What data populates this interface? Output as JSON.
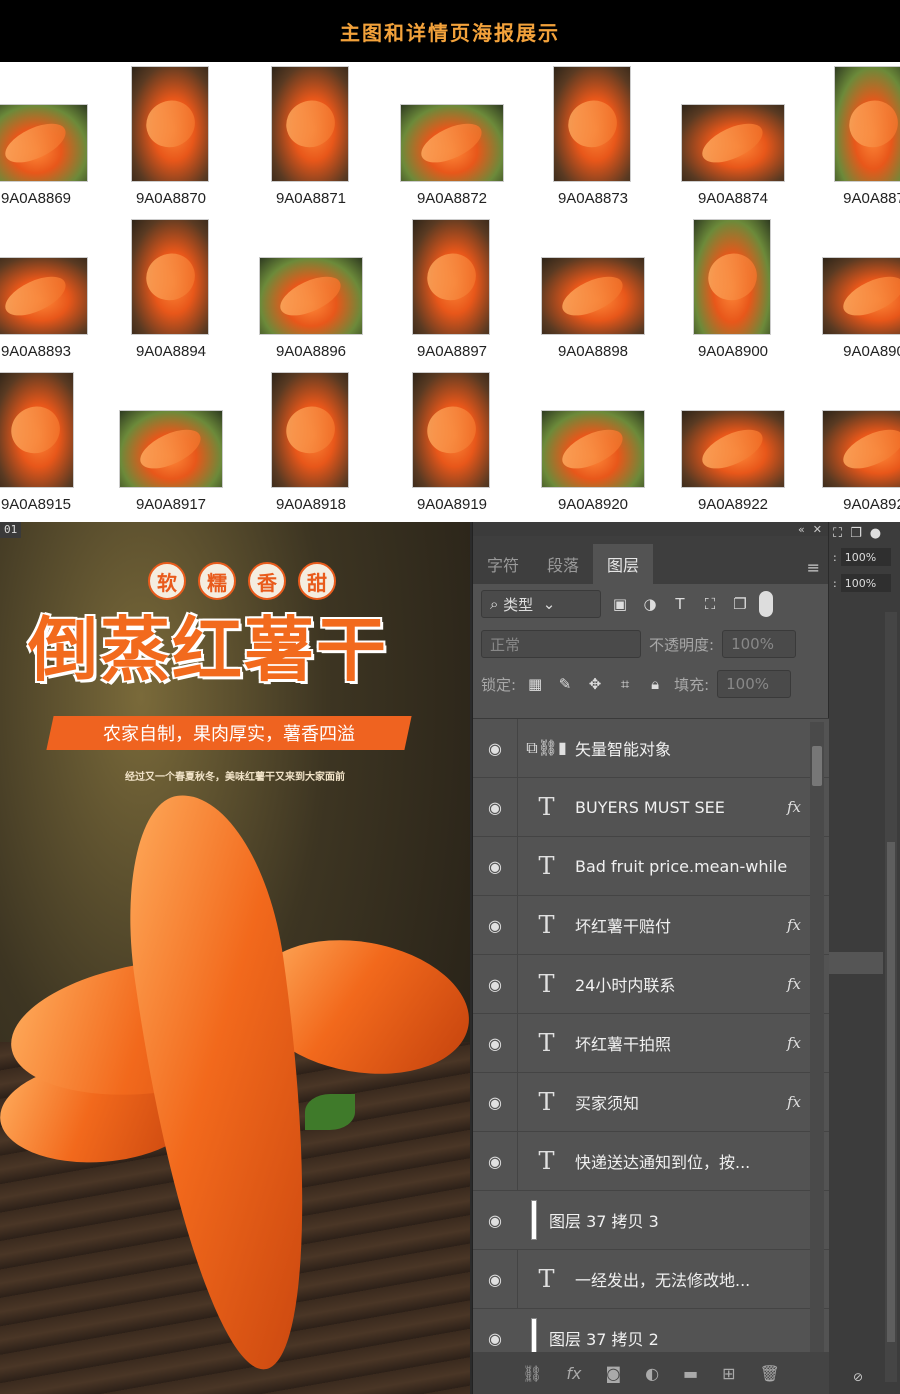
{
  "header": {
    "title": "主图和详情页海报展示"
  },
  "thumbnails": {
    "row1": [
      "9A0A8869",
      "9A0A8870",
      "9A0A8871",
      "9A0A8872",
      "9A0A8873",
      "9A0A8874",
      "9A0A887"
    ],
    "row2": [
      "9A0A8893",
      "9A0A8894",
      "9A0A8896",
      "9A0A8897",
      "9A0A8898",
      "9A0A8900",
      "9A0A890"
    ],
    "row3": [
      "9A0A8915",
      "9A0A8917",
      "9A0A8918",
      "9A0A8919",
      "9A0A8920",
      "9A0A8922",
      "9A0A892"
    ]
  },
  "poster": {
    "doc_tag": "01",
    "chips": [
      "软",
      "糯",
      "香",
      "甜"
    ],
    "title": "倒蒸红薯干",
    "banner": "农家自制，果肉厚实，薯香四溢",
    "subline": "经过又一个春夏秋冬，美味红薯干又来到大家面前"
  },
  "panel": {
    "tabs": [
      "字符",
      "段落",
      "图层"
    ],
    "active_tab": "图层",
    "filter_label": "类型",
    "blend_mode": "正常",
    "opacity_label": "不透明度:",
    "opacity_value": "100%",
    "lock_label": "锁定:",
    "fill_label": "填充:",
    "fill_value": "100%",
    "layers": [
      {
        "name": "矢量智能对象",
        "kind": "smart",
        "fx": false
      },
      {
        "name": "BUYERS MUST SEE",
        "kind": "text",
        "fx": true
      },
      {
        "name": "Bad fruit price.mean-while",
        "kind": "text",
        "fx": false
      },
      {
        "name": "坏红薯干赔付",
        "kind": "text",
        "fx": true
      },
      {
        "name": "24小时内联系",
        "kind": "text",
        "fx": true
      },
      {
        "name": "坏红薯干拍照",
        "kind": "text",
        "fx": true
      },
      {
        "name": "买家须知",
        "kind": "text",
        "fx": true
      },
      {
        "name": "快递送达通知到位，按...",
        "kind": "text",
        "fx": false
      },
      {
        "name": "图层 37 拷贝 3",
        "kind": "pixel",
        "fx": false
      },
      {
        "name": "一经发出，无法修改地...",
        "kind": "text",
        "fx": false
      },
      {
        "name": "图层 37 拷贝 2",
        "kind": "pixel",
        "fx": false
      }
    ],
    "text_glyph": "T",
    "fx_glyph": "fx"
  },
  "strip": {
    "pct1": "100%",
    "pct2": "100%"
  }
}
